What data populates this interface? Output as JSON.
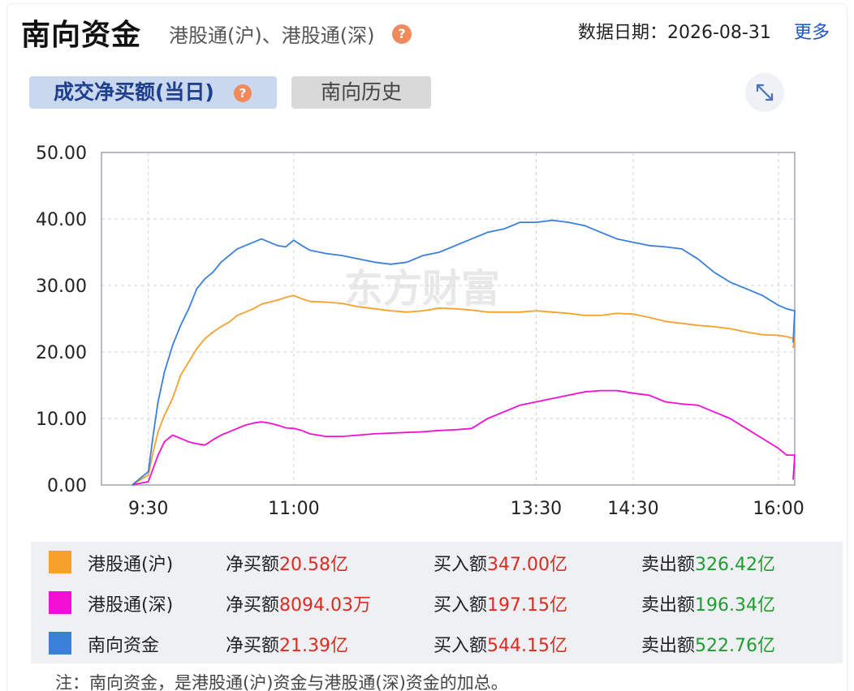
{
  "header": {
    "title": "南向资金",
    "subtitle": "港股通(沪)、港股通(深)",
    "help_glyph": "?",
    "date_label": "数据日期：2026-08-31",
    "more": "更多"
  },
  "tabs": [
    {
      "label": "成交净买额(当日)",
      "active": true
    },
    {
      "label": "南向历史",
      "active": false
    }
  ],
  "watermark": "东方财富",
  "colors": {
    "hu": "#f5a12c",
    "shen": "#f00fd2",
    "total": "#3a7fd8",
    "net_value": "#e0291f",
    "sell_value": "#1e9e2e",
    "accent_link": "#1f54c4"
  },
  "chart_data": {
    "type": "line",
    "ylim": [
      0,
      50
    ],
    "y_ticks": [
      "0.00",
      "10.00",
      "20.00",
      "30.00",
      "40.00",
      "50.00"
    ],
    "x_ticks": [
      "9:30",
      "11:00",
      "13:30",
      "14:30",
      "16:00"
    ],
    "x": [
      "9:20",
      "9:30",
      "9:33",
      "9:36",
      "9:40",
      "9:45",
      "9:50",
      "9:55",
      "10:00",
      "10:05",
      "10:10",
      "10:15",
      "10:20",
      "10:25",
      "10:30",
      "10:35",
      "10:40",
      "10:45",
      "10:50",
      "10:55",
      "11:00",
      "11:05",
      "11:10",
      "11:20",
      "11:30",
      "11:40",
      "11:50",
      "12:00",
      "12:10",
      "12:20",
      "12:30",
      "12:40",
      "12:50",
      "13:00",
      "13:10",
      "13:20",
      "13:30",
      "13:40",
      "13:50",
      "14:00",
      "14:10",
      "14:20",
      "14:30",
      "14:40",
      "14:50",
      "15:00",
      "15:10",
      "15:20",
      "15:30",
      "15:40",
      "15:50",
      "16:00",
      "16:05",
      "16:10"
    ],
    "series": [
      {
        "name": "港股通(沪)",
        "values": [
          0.0,
          1.5,
          5.0,
          8.0,
          10.5,
          13.0,
          16.5,
          18.5,
          20.5,
          22.0,
          23.0,
          23.8,
          24.5,
          25.5,
          26.0,
          26.5,
          27.2,
          27.5,
          27.8,
          28.2,
          28.5,
          28.0,
          27.6,
          27.5,
          27.3,
          26.8,
          26.5,
          26.2,
          26.0,
          26.2,
          26.6,
          26.5,
          26.3,
          26.0,
          26.0,
          26.0,
          26.2,
          26.0,
          25.8,
          25.5,
          25.5,
          25.8,
          25.7,
          25.2,
          24.6,
          24.3,
          24.0,
          23.8,
          23.5,
          23.0,
          22.6,
          22.5,
          22.3,
          22.0,
          20.58
        ]
      },
      {
        "name": "港股通(深)",
        "values": [
          0.0,
          0.5,
          2.5,
          4.5,
          6.5,
          7.5,
          7.0,
          6.5,
          6.2,
          6.0,
          6.8,
          7.5,
          8.0,
          8.5,
          9.0,
          9.3,
          9.5,
          9.3,
          9.0,
          8.6,
          8.5,
          8.2,
          7.7,
          7.3,
          7.3,
          7.5,
          7.7,
          7.8,
          7.9,
          8.0,
          8.2,
          8.3,
          8.5,
          10.0,
          11.0,
          12.0,
          12.5,
          13.0,
          13.5,
          14.0,
          14.2,
          14.2,
          13.8,
          13.5,
          12.5,
          12.2,
          12.0,
          11.0,
          10.0,
          8.5,
          7.0,
          5.5,
          4.5,
          4.5,
          0.81
        ]
      },
      {
        "name": "南向资金",
        "values": [
          0.0,
          2.0,
          7.5,
          12.5,
          17.0,
          21.0,
          24.0,
          26.5,
          29.5,
          31.0,
          32.0,
          33.5,
          34.5,
          35.5,
          36.0,
          36.5,
          37.0,
          36.5,
          36.0,
          35.8,
          36.8,
          36.0,
          35.3,
          34.8,
          34.5,
          34.0,
          33.5,
          33.2,
          33.5,
          34.5,
          35.0,
          36.0,
          37.0,
          38.0,
          38.5,
          39.5,
          39.5,
          39.8,
          39.5,
          39.0,
          38.0,
          37.0,
          36.5,
          36.0,
          35.8,
          35.5,
          34.0,
          32.0,
          30.5,
          29.5,
          28.5,
          27.0,
          26.5,
          26.2,
          21.39
        ]
      }
    ]
  },
  "legend": [
    {
      "name": "港股通(沪)",
      "net_label": "净买额",
      "net_value": "20.58亿",
      "buy_label": "买入额",
      "buy_value": "347.00亿",
      "sell_label": "卖出额",
      "sell_value": "326.42亿"
    },
    {
      "name": "港股通(深)",
      "net_label": "净买额",
      "net_value": "8094.03万",
      "buy_label": "买入额",
      "buy_value": "197.15亿",
      "sell_label": "卖出额",
      "sell_value": "196.34亿"
    },
    {
      "name": "南向资金",
      "net_label": "净买额",
      "net_value": "21.39亿",
      "buy_label": "买入额",
      "buy_value": "544.15亿",
      "sell_label": "卖出额",
      "sell_value": "522.76亿"
    }
  ],
  "note": "注：南向资金，是港股通(沪)资金与港股通(深)资金的加总。"
}
